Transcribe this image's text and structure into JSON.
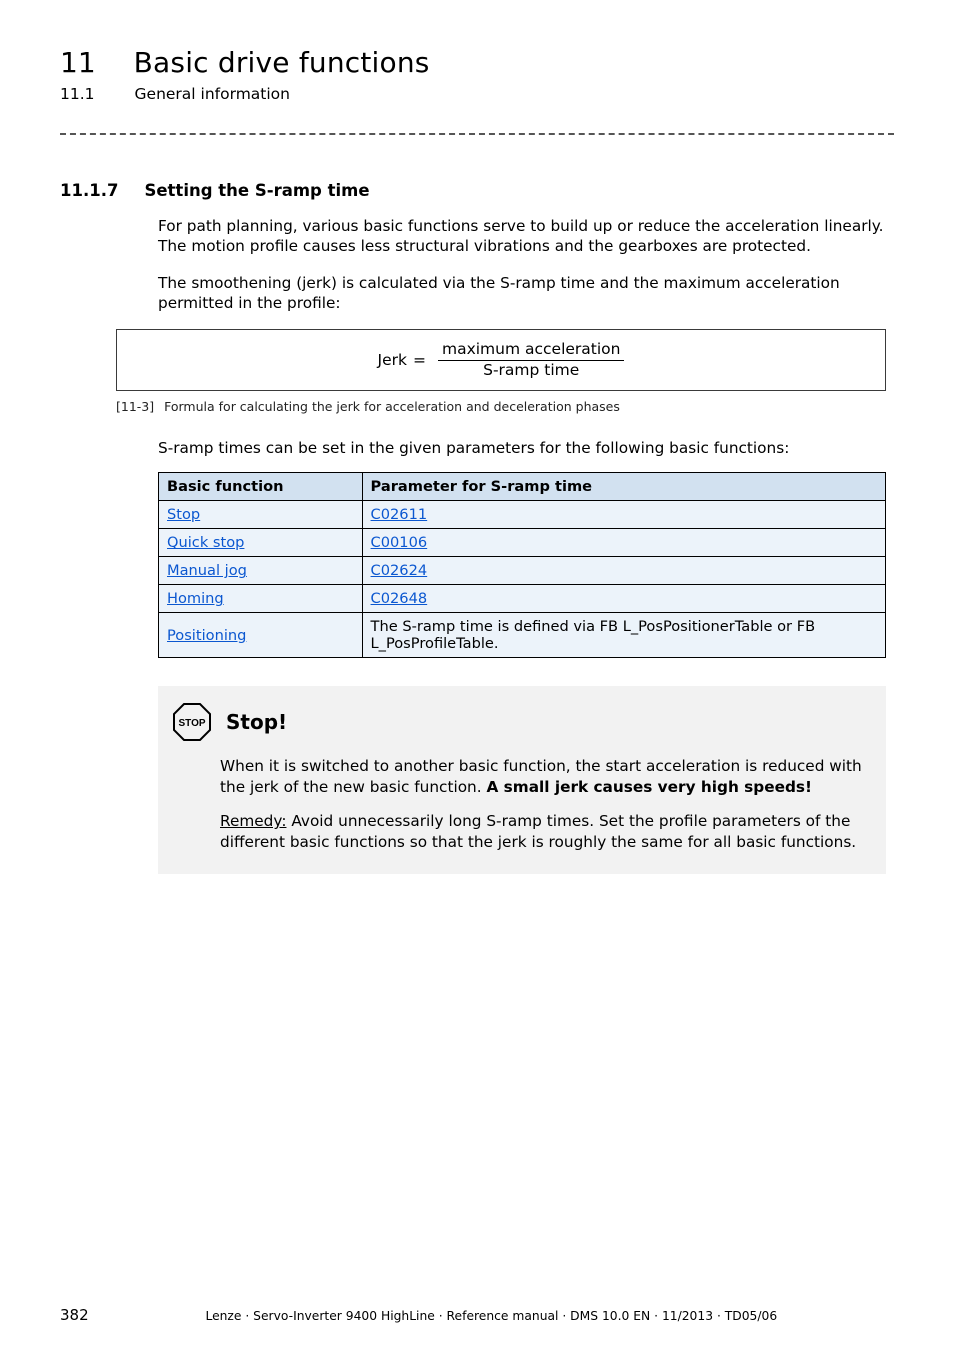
{
  "chapter": {
    "number": "11",
    "title": "Basic drive functions"
  },
  "subsection": {
    "number": "11.1",
    "title": "General information"
  },
  "section": {
    "number": "11.1.7",
    "title": "Setting the S-ramp time"
  },
  "paragraphs": {
    "p1": "For path planning, various basic functions serve to build up or reduce the acceleration linearly. The motion profile causes less structural vibrations and the gearboxes are protected.",
    "p2": "The smoothening (jerk) is calculated via the S-ramp time and the maximum acceleration permitted in the profile:",
    "p3": "S-ramp times can be set in the given parameters for the following basic functions:"
  },
  "formula": {
    "lhs": "Jerk",
    "eq": "=",
    "numerator": "maximum acceleration",
    "denominator": "S-ramp time"
  },
  "formula_caption": {
    "ref": "[11-3]",
    "text": "Formula for calculating the jerk for acceleration and deceleration phases"
  },
  "table": {
    "headers": {
      "c1": "Basic function",
      "c2": "Parameter for S-ramp time"
    },
    "rows": [
      {
        "fn": "Stop",
        "param": "C02611",
        "param_is_link": true
      },
      {
        "fn": "Quick stop",
        "param": "C00106",
        "param_is_link": true
      },
      {
        "fn": "Manual jog",
        "param": "C02624",
        "param_is_link": true
      },
      {
        "fn": "Homing",
        "param": "C02648",
        "param_is_link": true
      },
      {
        "fn": "Positioning",
        "param": "The S-ramp time is defined via FB L_PosPositionerTable or FB L_PosProfileTable.",
        "param_is_link": false
      }
    ]
  },
  "callout": {
    "icon_label": "STOP",
    "title": "Stop!",
    "p1_a": "When it is switched to another basic function, the start acceleration is reduced with the jerk of the new basic function. ",
    "p1_b": "A small jerk causes very high speeds!",
    "p2_lead": "Remedy:",
    "p2_rest": " Avoid unnecessarily long S-ramp times. Set the profile parameters of the different basic functions so that the jerk is roughly the same for all basic functions."
  },
  "footer": {
    "page": "382",
    "text": "Lenze · Servo-Inverter 9400 HighLine · Reference manual · DMS 10.0 EN · 11/2013 · TD05/06"
  }
}
